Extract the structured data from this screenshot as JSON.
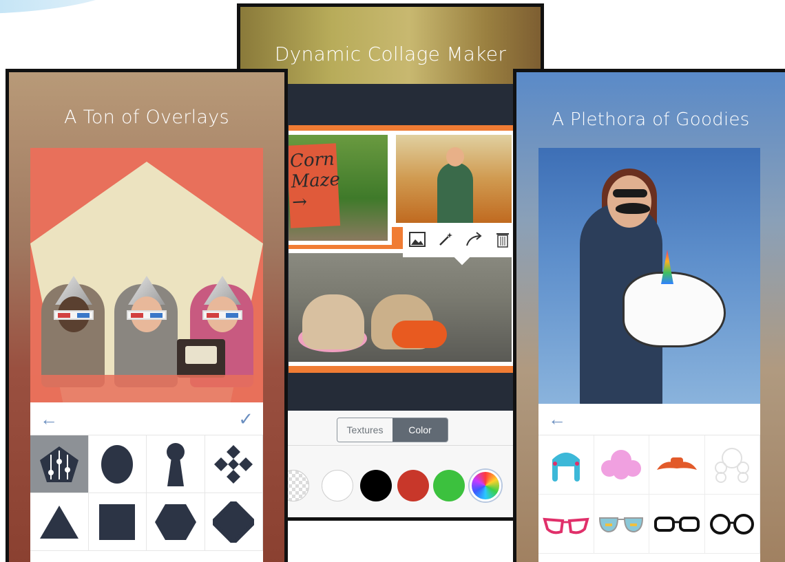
{
  "panels": {
    "left": {
      "title": "A Ton of Overlays"
    },
    "middle": {
      "title": "Dynamic Collage Maker"
    },
    "right": {
      "title": "A Plethora of Goodies"
    }
  },
  "left_toolbar": {
    "back_icon": "←",
    "confirm_icon": "✓"
  },
  "overlay_shapes": [
    "pentagon-adjust",
    "oval",
    "keyhole",
    "diamond-cluster",
    "triangle",
    "square",
    "hexagon",
    "diamond"
  ],
  "collage": {
    "sign_text": "Corn Maze →",
    "edit_tools": [
      "image-icon",
      "magic-wand-icon",
      "redo-arrow-icon",
      "trash-icon"
    ]
  },
  "middle_toolbar": {
    "segments": [
      "Textures",
      "Color"
    ],
    "selected_segment": "Color",
    "swatches": [
      {
        "name": "transparent",
        "color": "checker"
      },
      {
        "name": "white",
        "color": "#ffffff"
      },
      {
        "name": "black",
        "color": "#000000"
      },
      {
        "name": "red",
        "color": "#c8372a"
      },
      {
        "name": "green",
        "color": "#3cc13e"
      },
      {
        "name": "color-wheel",
        "color": "rainbow"
      }
    ]
  },
  "right_toolbar": {
    "back_icon": "←"
  },
  "goodies": [
    {
      "name": "blue-pigtails-wig",
      "color": "#3cb8d8"
    },
    {
      "name": "pink-curly-wig",
      "color": "#f0a0e0"
    },
    {
      "name": "orange-mustache",
      "color": "#e25a2a"
    },
    {
      "name": "white-curly-wig",
      "color": "#f0f0f0"
    },
    {
      "name": "pink-cateye-glasses",
      "color": "#e0306a"
    },
    {
      "name": "aviator-sunglasses",
      "color": "#8ac8d8"
    },
    {
      "name": "black-glasses",
      "color": "#111111"
    },
    {
      "name": "round-glasses",
      "color": "#111111"
    }
  ],
  "colors": {
    "accent_blue": "#6b8fc0",
    "shape_dark": "#2c3445",
    "collage_orange": "#f07c34"
  }
}
